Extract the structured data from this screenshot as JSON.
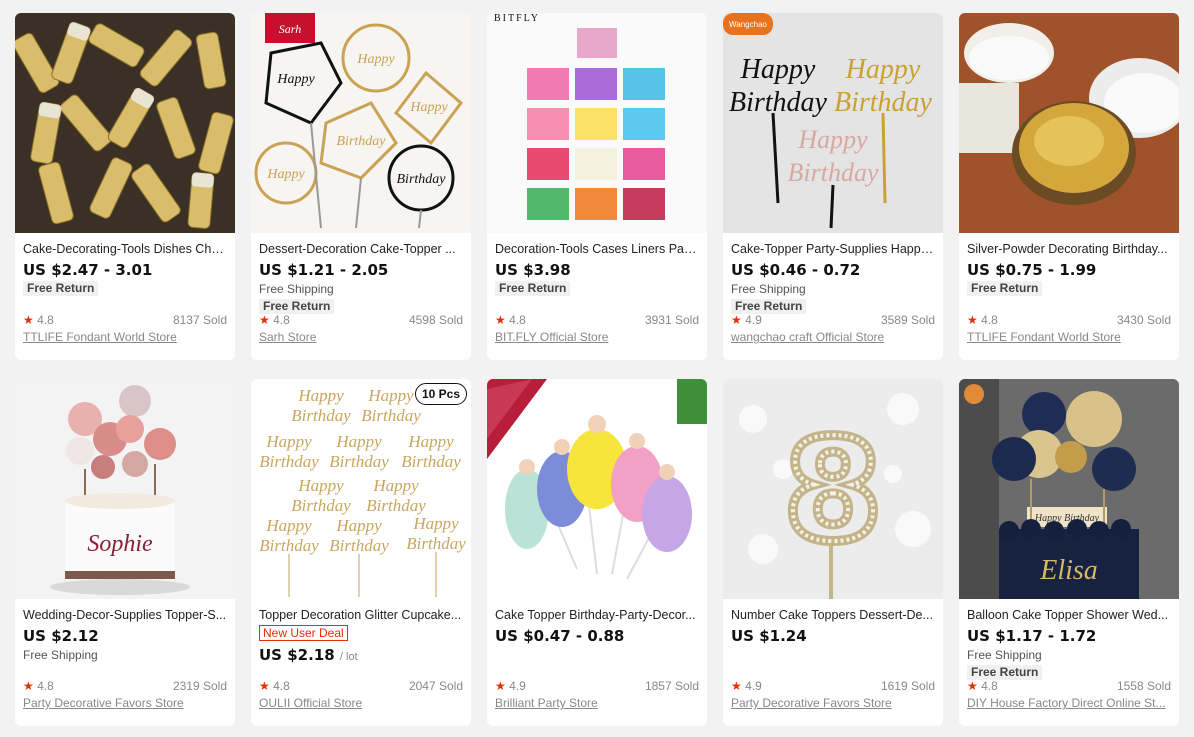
{
  "products": [
    {
      "title": "Cake-Decorating-Tools Dishes Cho...",
      "price": "US $2.47 - 3.01",
      "unit": "",
      "shipping": "",
      "badge": "Free Return",
      "deal": "",
      "rating": "4.8",
      "sold": "8137 Sold",
      "store": "TTLIFE Fondant World Store",
      "image": "gold-leaf-vials"
    },
    {
      "title": "Dessert-Decoration Cake-Topper ...",
      "price": "US $1.21 - 2.05",
      "unit": "",
      "shipping": "Free Shipping",
      "badge": "Free Return",
      "deal": "",
      "rating": "4.8",
      "sold": "4598 Sold",
      "store": "Sarh Store",
      "image": "birthday-toppers"
    },
    {
      "title": "Decoration-Tools Cases Liners Pap...",
      "price": "US $3.98",
      "unit": "",
      "shipping": "",
      "badge": "Free Return",
      "deal": "",
      "rating": "4.8",
      "sold": "3931 Sold",
      "store": "BIT.FLY Official Store",
      "image": "cupcake-liners"
    },
    {
      "title": "Cake-Topper Party-Supplies Happy...",
      "price": "US $0.46 - 0.72",
      "unit": "",
      "shipping": "Free Shipping",
      "badge": "Free Return",
      "deal": "",
      "rating": "4.9",
      "sold": "3589 Sold",
      "store": "wangchao craft Official Store",
      "image": "acrylic-toppers"
    },
    {
      "title": "Silver-Powder Decorating Birthday...",
      "price": "US $0.75 - 1.99",
      "unit": "",
      "shipping": "",
      "badge": "Free Return",
      "deal": "",
      "rating": "4.8",
      "sold": "3430 Sold",
      "store": "TTLIFE Fondant World Store",
      "image": "gold-powder-jar"
    },
    {
      "title": "Wedding-Decor-Supplies Topper-S...",
      "price": "US $2.12",
      "unit": "",
      "shipping": "Free Shipping",
      "badge": "",
      "deal": "",
      "rating": "4.8",
      "sold": "2319 Sold",
      "store": "Party Decorative Favors Store",
      "image": "balloon-cake-pink"
    },
    {
      "title": "Topper Decoration Glitter Cupcake...",
      "price": "US $2.18",
      "unit": "/ lot",
      "shipping": "",
      "badge": "",
      "deal": "New User Deal",
      "rating": "4.8",
      "sold": "2047 Sold",
      "store": "OULII Official Store",
      "image": "glitter-toppers"
    },
    {
      "title": "Cake Topper Birthday-Party-Decor...",
      "price": "US $0.47 - 0.88",
      "unit": "",
      "shipping": "",
      "badge": "",
      "deal": "",
      "rating": "4.9",
      "sold": "1857 Sold",
      "store": "Brilliant Party Store",
      "image": "princess-toppers"
    },
    {
      "title": "Number Cake Toppers Dessert-De...",
      "price": "US $1.24",
      "unit": "",
      "shipping": "",
      "badge": "",
      "deal": "",
      "rating": "4.9",
      "sold": "1619 Sold",
      "store": "Party Decorative Favors Store",
      "image": "rhinestone-number"
    },
    {
      "title": "Balloon Cake Topper Shower Wed...",
      "price": "US $1.17 - 1.72",
      "unit": "",
      "shipping": "Free Shipping",
      "badge": "Free Return",
      "deal": "",
      "rating": "4.8",
      "sold": "1558 Sold",
      "store": "DIY House Factory Direct Online St...",
      "image": "balloon-cake-navy"
    }
  ],
  "image_text": {
    "sarh_logo": "Sarh",
    "bitfly_logo": "BITFLY",
    "wangchao_logo": "Wangchao",
    "happy": "Happy",
    "birthday": "Birthday",
    "sophie": "Sophie",
    "pcs": "10 Pcs",
    "elisa": "Elisa",
    "happy_birthday": "Happy Birthday",
    "eight": "8"
  },
  "colors": {
    "star": "#e62e04",
    "deal": "#e62e04",
    "price": "#111111",
    "muted": "#888888"
  }
}
